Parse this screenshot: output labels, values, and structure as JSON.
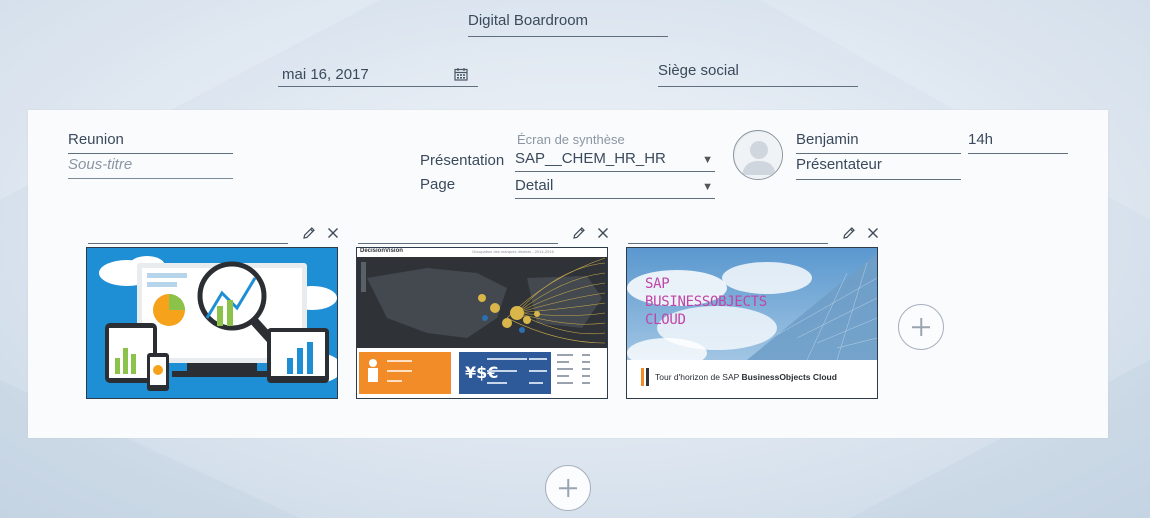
{
  "header": {
    "title": "Digital Boardroom",
    "date": "mai 16, 2017",
    "location": "Siège social"
  },
  "meeting": {
    "title": "Reunion",
    "subtitle_placeholder": "Sous-titre",
    "summary_screen_label": "Écran de synthèse",
    "presentation_label": "Présentation",
    "presentation_value": "SAP__CHEM_HR_HR",
    "page_label": "Page",
    "page_value": "Detail",
    "presenter_name": "Benjamin",
    "presenter_role": "Présentateur",
    "time": "14h"
  },
  "cards": [
    {
      "title": "",
      "thumbnail": "analytics-illustration"
    },
    {
      "title": "",
      "thumbnail": "dashboard-map",
      "brand": "DecisionVision",
      "subtitle": "Occupation des marqués districts - 2014-2016"
    },
    {
      "title": "",
      "thumbnail": "sap-cloud-tour",
      "headline": [
        "SAP",
        "BUSINESSOBJECTS",
        "CLOUD"
      ],
      "caption_prefix": "Tour d'horizon de SAP ",
      "caption_bold": "BusinessObjects Cloud"
    }
  ],
  "icons": {
    "calendar": "calendar-icon",
    "edit": "pencil-icon",
    "close": "close-icon",
    "add": "plus-icon",
    "avatar": "user-avatar-icon"
  },
  "colors": {
    "accent_magenta": "#c045a8",
    "dashboard_orange": "#f28c28",
    "dashboard_blue": "#2f5a9a"
  }
}
